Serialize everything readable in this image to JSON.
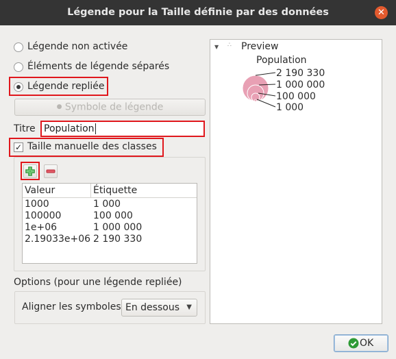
{
  "window": {
    "title": "Légende pour la Taille définie par des données",
    "close_glyph": "✕"
  },
  "legend_modes": [
    {
      "label": "Légende non activée",
      "checked": false
    },
    {
      "label": "Éléments de légende séparés",
      "checked": false
    },
    {
      "label": "Légende repliée",
      "checked": true
    }
  ],
  "symbol_button": {
    "label": "Symbole de légende",
    "enabled": false
  },
  "title_field": {
    "label": "Titre",
    "value": "Population"
  },
  "manual_classes": {
    "label": "Taille manuelle des classes",
    "checked": true,
    "check_glyph": "✓"
  },
  "toolbar": {
    "add_icon": "plus-icon",
    "remove_icon": "minus-icon"
  },
  "classes_table": {
    "headers": [
      "Valeur",
      "Étiquette"
    ],
    "rows": [
      [
        "1000",
        "1 000"
      ],
      [
        "100000",
        "100 000"
      ],
      [
        "1e+06",
        "1 000 000"
      ],
      [
        "2.19033e+06",
        "2 190 330"
      ]
    ]
  },
  "options": {
    "heading": "Options (pour une légende repliée)",
    "align_label": "Aligner les symboles",
    "align_value": "En dessous"
  },
  "preview": {
    "root_label": "Preview",
    "title": "Population",
    "labels": [
      "2 190 330",
      "1 000 000",
      "100 000",
      "1 000"
    ],
    "symbol_color": "#e8a0b4"
  },
  "ok_button": {
    "label": "OK"
  },
  "colors": {
    "highlight": "#e0161c",
    "accent": "#2e9a36"
  }
}
